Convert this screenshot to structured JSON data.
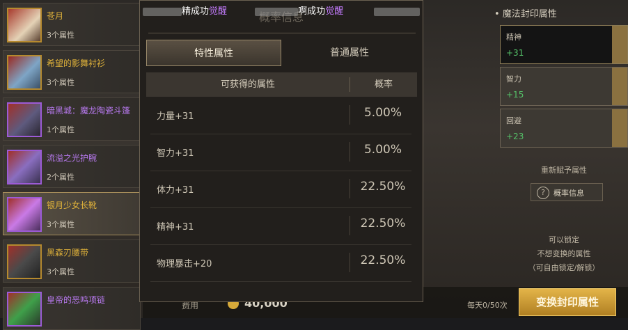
{
  "notification": {
    "part1": "精成功",
    "awaken1": "觉醒",
    "part2": "啊成功",
    "awaken2": "觉醒"
  },
  "items": [
    {
      "name": "苍月",
      "attr": "3个属性",
      "color": "gold"
    },
    {
      "name": "希望的影舞衬衫",
      "attr": "3个属性",
      "color": "gold"
    },
    {
      "name": "暗黑城：魔龙陶瓷斗篷",
      "attr": "1个属性",
      "color": "purple"
    },
    {
      "name": "流溢之光护腕",
      "attr": "2个属性",
      "color": "purple"
    },
    {
      "name": "银月少女长靴",
      "attr": "3个属性",
      "color": "purple",
      "selected": true
    },
    {
      "name": "黑森刃腰带",
      "attr": "3个属性",
      "color": "gold"
    },
    {
      "name": "皇帝的恶鸣项链",
      "attr": "",
      "color": "purple"
    }
  ],
  "right_panel": {
    "title": "• 魔法封印属性",
    "slots": [
      {
        "name": "精神",
        "value": "+31"
      },
      {
        "name": "智力",
        "value": "+15"
      },
      {
        "name": "回避",
        "value": "+23"
      }
    ],
    "reassign_label": "重新赋予属性",
    "prob_info_button": "概率信息",
    "lock_text_1": "可以锁定",
    "lock_text_2": "不想变换的属性",
    "lock_text_3": "（可自由锁定/解锁）"
  },
  "bottom": {
    "cost_label": "费用",
    "cost_value": "40,000",
    "daily_label": "每天0/50次",
    "exchange_button": "变换封印属性"
  },
  "modal": {
    "title": "概率信息",
    "tabs": [
      "特性属性",
      "普通属性"
    ],
    "columns": [
      "可获得的属性",
      "概率"
    ],
    "rows": [
      {
        "attr": "力量+31",
        "prob": "5.00%"
      },
      {
        "attr": "智力+31",
        "prob": "5.00%"
      },
      {
        "attr": "体力+31",
        "prob": "22.50%"
      },
      {
        "attr": "精神+31",
        "prob": "22.50%"
      },
      {
        "attr": "物理暴击+20",
        "prob": "22.50%"
      }
    ]
  }
}
